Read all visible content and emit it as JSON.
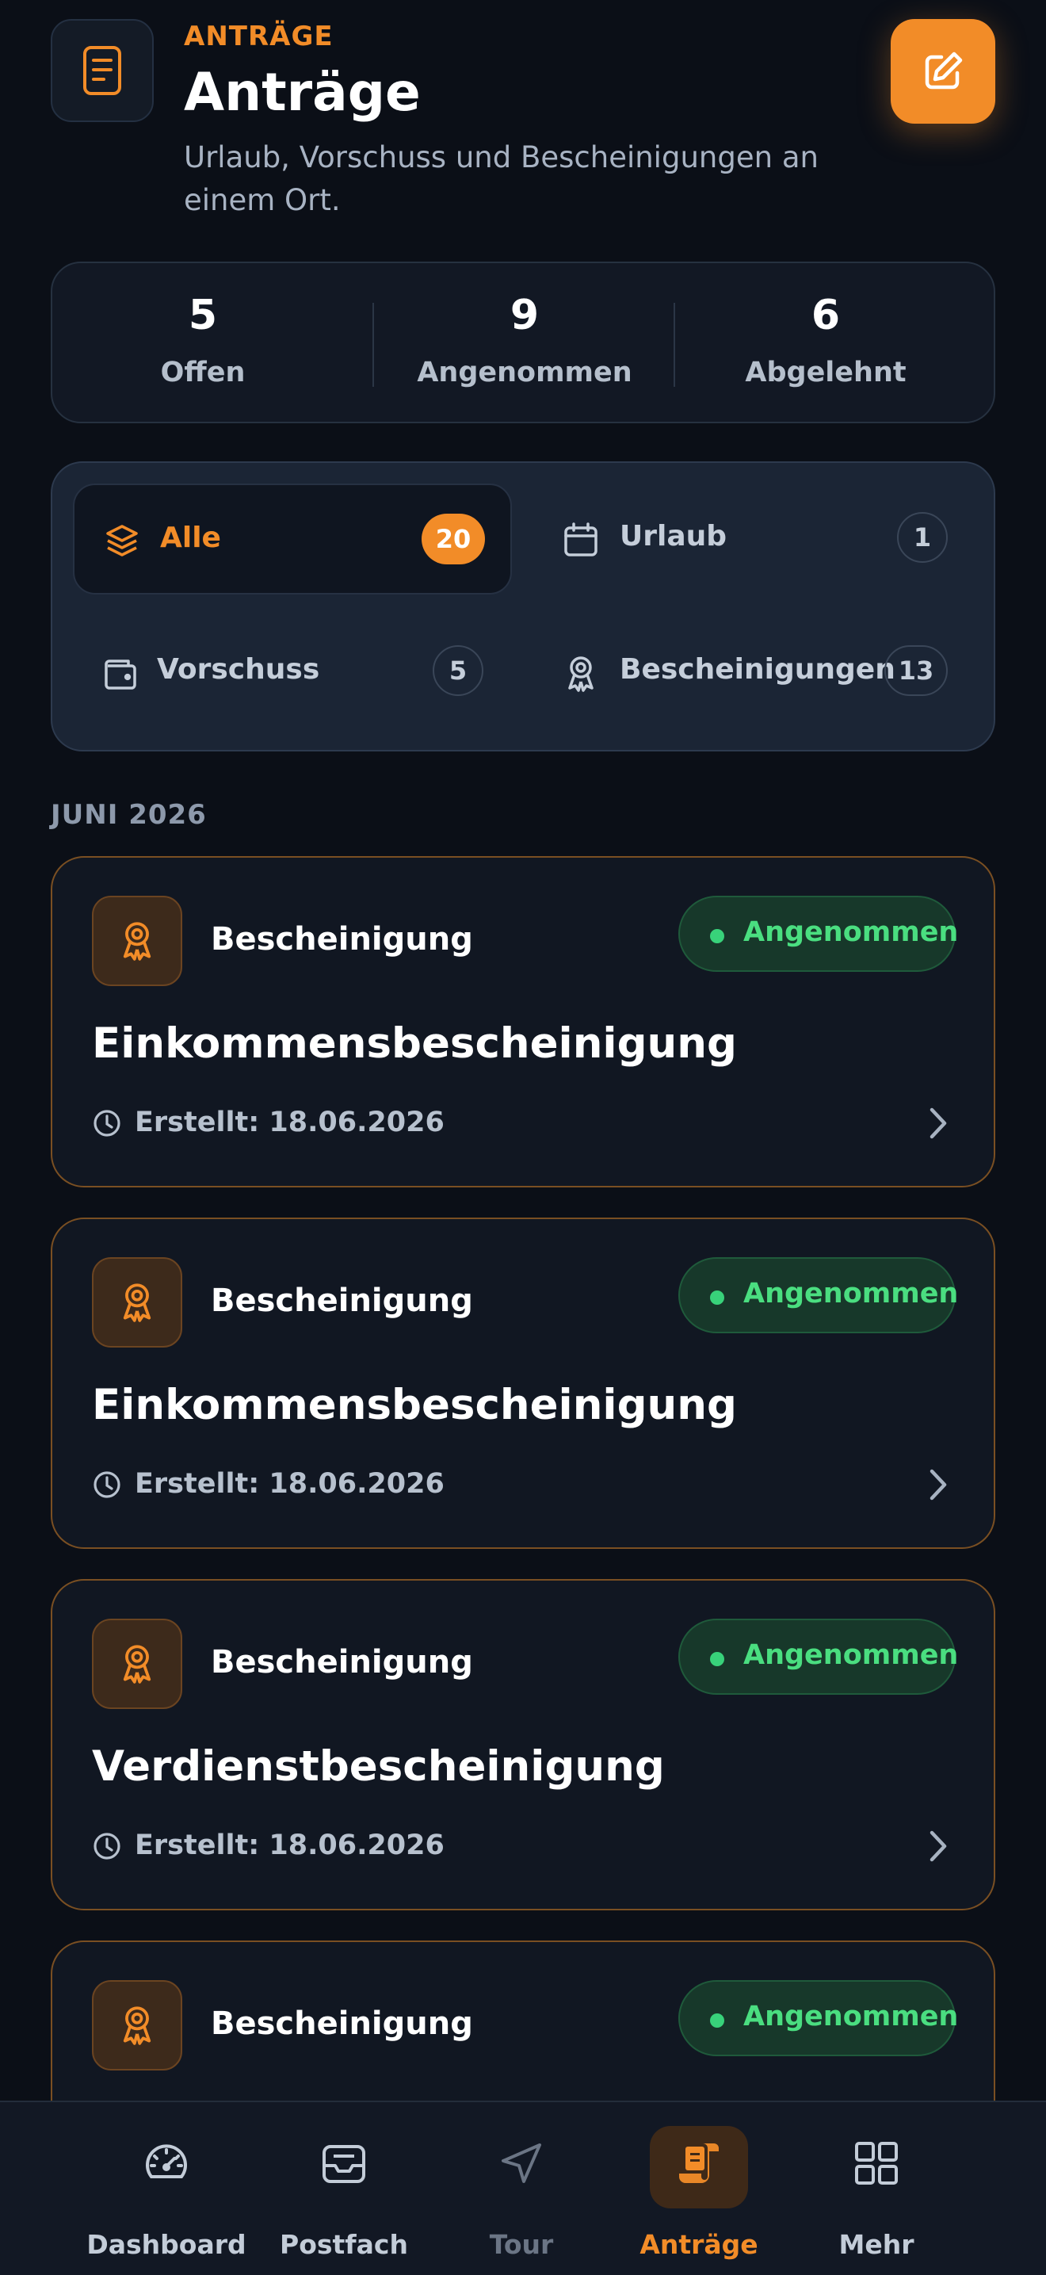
{
  "header": {
    "eyebrow": "ANTRÄGE",
    "title": "Anträge",
    "subtitle": "Urlaub, Vorschuss und Bescheinigungen an einem Ort.",
    "icon": "document-icon",
    "action_icon": "compose-icon"
  },
  "stats": [
    {
      "value": "5",
      "label": "Offen"
    },
    {
      "value": "9",
      "label": "Angenommen"
    },
    {
      "value": "6",
      "label": "Abgelehnt"
    }
  ],
  "filters": [
    {
      "label": "Alle",
      "count": "20",
      "icon": "layers-icon",
      "active": true
    },
    {
      "label": "Urlaub",
      "count": "1",
      "icon": "calendar-icon",
      "active": false
    },
    {
      "label": "Vorschuss",
      "count": "5",
      "icon": "wallet-icon",
      "active": false
    },
    {
      "label": "Bescheinigungen",
      "count": "13",
      "icon": "award-icon",
      "active": false
    }
  ],
  "section_label": "JUNI 2026",
  "cards": [
    {
      "type": "Bescheinigung",
      "status": "Angenommen",
      "title": "Einkommensbescheinigung",
      "created": "Erstellt: 18.06.2026"
    },
    {
      "type": "Bescheinigung",
      "status": "Angenommen",
      "title": "Einkommensbescheinigung",
      "created": "Erstellt: 18.06.2026"
    },
    {
      "type": "Bescheinigung",
      "status": "Angenommen",
      "title": "Verdienstbescheinigung",
      "created": "Erstellt: 18.06.2026"
    },
    {
      "type": "Bescheinigung",
      "status": "Angenommen",
      "title": "",
      "created": ""
    }
  ],
  "nav": [
    {
      "label": "Dashboard",
      "icon": "gauge-icon",
      "state": "normal"
    },
    {
      "label": "Postfach",
      "icon": "inbox-icon",
      "state": "normal"
    },
    {
      "label": "Tour",
      "icon": "navigation-icon",
      "state": "disabled"
    },
    {
      "label": "Anträge",
      "icon": "scroll-icon",
      "state": "active"
    },
    {
      "label": "Mehr",
      "icon": "grid-icon",
      "state": "normal"
    }
  ],
  "colors": {
    "accent": "#f28c28",
    "success": "#4ade80",
    "background": "#0b0f17"
  }
}
